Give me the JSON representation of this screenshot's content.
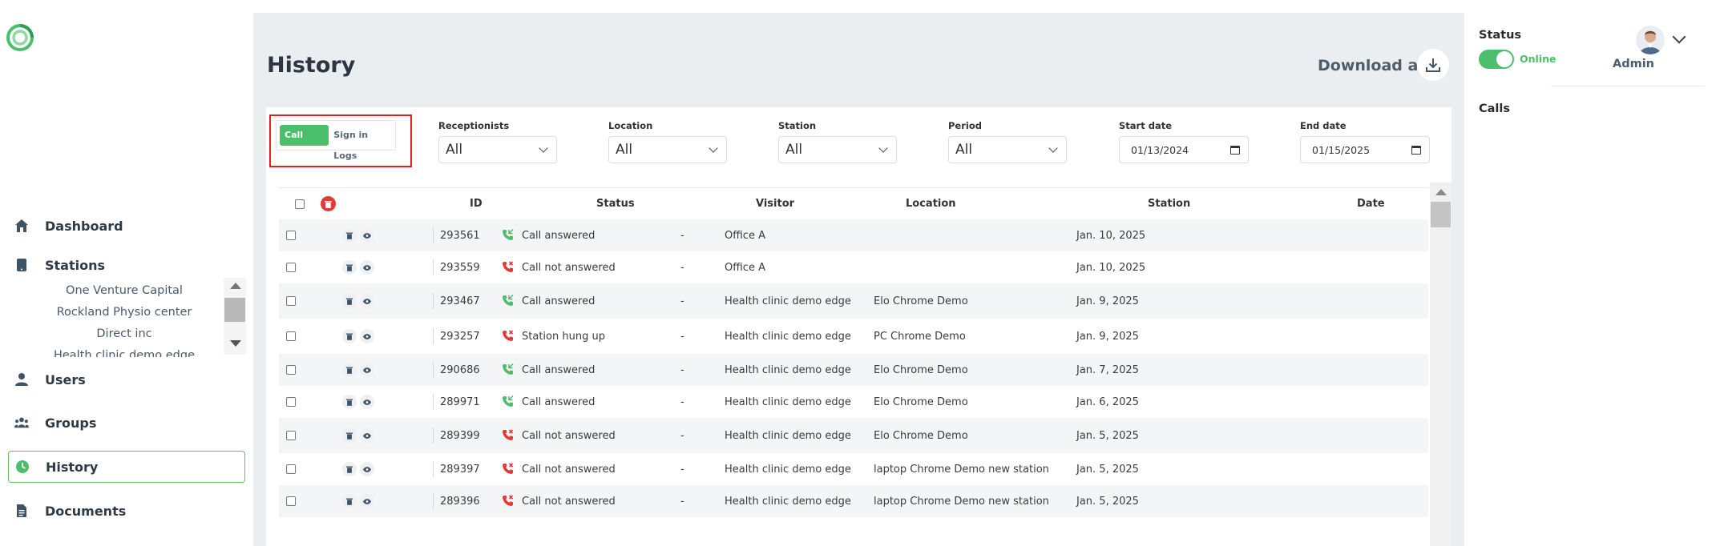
{
  "nav": {
    "dashboard": "Dashboard",
    "stations": "Stations",
    "users": "Users",
    "groups": "Groups",
    "history": "History",
    "documents": "Documents"
  },
  "stations_list": [
    "One Venture Capital",
    "Rockland Physio center",
    "Direct inc",
    "Health clinic demo edge"
  ],
  "page": {
    "title": "History",
    "download_label": "Download all"
  },
  "tabs": {
    "call_logs": "Call Logs",
    "sign_in_logs": "Sign in Logs"
  },
  "filters": {
    "receptionists": {
      "label": "Receptionists",
      "value": "All"
    },
    "location": {
      "label": "Location",
      "value": "All"
    },
    "station": {
      "label": "Station",
      "value": "All"
    },
    "period": {
      "label": "Period",
      "value": "All"
    },
    "start_date": {
      "label": "Start date",
      "value": "01/13/2024"
    },
    "end_date": {
      "label": "End date",
      "value": "01/15/2025"
    }
  },
  "table": {
    "columns": {
      "id": "ID",
      "status": "Status",
      "visitor": "Visitor",
      "location": "Location",
      "station": "Station",
      "date": "Date"
    },
    "rows": [
      {
        "id": "293561",
        "status": "Call answered",
        "answered": true,
        "visitor": "-",
        "location": "Office A",
        "station": "",
        "date": "Jan. 10, 2025"
      },
      {
        "id": "293559",
        "status": "Call not answered",
        "answered": false,
        "visitor": "-",
        "location": "Office A",
        "station": "",
        "date": "Jan. 10, 2025"
      },
      {
        "id": "293467",
        "status": "Call answered",
        "answered": true,
        "visitor": "-",
        "location": "Health clinic demo edge",
        "station": "Elo Chrome Demo",
        "date": "Jan. 9, 2025"
      },
      {
        "id": "293257",
        "status": "Station hung up",
        "answered": false,
        "visitor": "-",
        "location": "Health clinic demo edge",
        "station": "PC Chrome Demo",
        "date": "Jan. 9, 2025"
      },
      {
        "id": "290686",
        "status": "Call answered",
        "answered": true,
        "visitor": "-",
        "location": "Health clinic demo edge",
        "station": "Elo Chrome Demo",
        "date": "Jan. 7, 2025"
      },
      {
        "id": "289971",
        "status": "Call answered",
        "answered": true,
        "visitor": "-",
        "location": "Health clinic demo edge",
        "station": "Elo Chrome Demo",
        "date": "Jan. 6, 2025"
      },
      {
        "id": "289399",
        "status": "Call not answered",
        "answered": false,
        "visitor": "-",
        "location": "Health clinic demo edge",
        "station": "Elo Chrome Demo",
        "date": "Jan. 5, 2025"
      },
      {
        "id": "289397",
        "status": "Call not answered",
        "answered": false,
        "visitor": "-",
        "location": "Health clinic demo edge",
        "station": "laptop Chrome Demo new station",
        "date": "Jan. 5, 2025"
      },
      {
        "id": "289396",
        "status": "Call not answered",
        "answered": false,
        "visitor": "-",
        "location": "Health clinic demo edge",
        "station": "laptop Chrome Demo new station",
        "date": "Jan. 5, 2025"
      }
    ]
  },
  "right_panel": {
    "status_label": "Status",
    "online_label": "Online",
    "user_name": "Admin",
    "calls_label": "Calls"
  },
  "colors": {
    "accent_green": "#4bbf6b",
    "missed_red": "#e53935",
    "highlight_red": "#e02020",
    "main_bg": "#ebeef1"
  }
}
